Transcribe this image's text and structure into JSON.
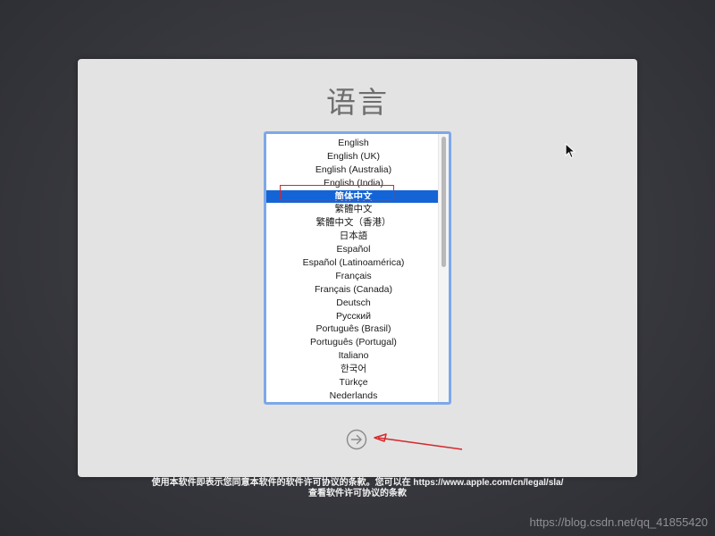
{
  "window": {
    "title": "语言"
  },
  "language_list": {
    "selected_index": 4,
    "items": [
      "English",
      "English (UK)",
      "English (Australia)",
      "English (India)",
      "简体中文",
      "繁體中文",
      "繁體中文（香港）",
      "日本語",
      "Español",
      "Español (Latinoamérica)",
      "Français",
      "Français (Canada)",
      "Deutsch",
      "Русский",
      "Português (Brasil)",
      "Português (Portugal)",
      "Italiano",
      "한국어",
      "Türkçe",
      "Nederlands"
    ]
  },
  "next_button": {
    "icon": "arrow-right-circle-icon"
  },
  "legal": {
    "line1_prefix": "使用本软件即表示您同意本软件的软件许可协议的条款。您可以在 ",
    "line1_link": "https://www.apple.com/cn/legal/sla/",
    "line2": "查看软件许可协议的条款"
  },
  "watermark": "https://blog.csdn.net/qq_41855420",
  "colors": {
    "selection": "#1564d6",
    "annotation": "#d6262b",
    "focus_ring": "#7ea7e8"
  }
}
